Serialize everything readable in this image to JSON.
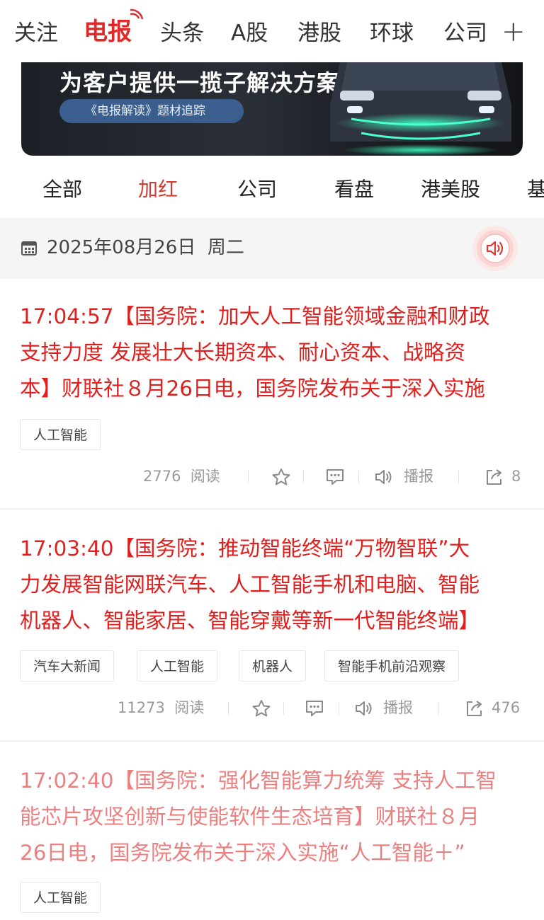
{
  "top_nav": {
    "tabs": [
      "关注",
      "电报",
      "头条",
      "A股",
      "港股",
      "环球",
      "公司"
    ],
    "active_index": 1,
    "add_label": "+"
  },
  "banner": {
    "headline": "为客户提供一揽子解决方案",
    "pill_label": "《电报解读》题材追踪"
  },
  "sub_tabs": {
    "items": [
      "全部",
      "加红",
      "公司",
      "看盘",
      "港美股",
      "基"
    ],
    "active_index": 1
  },
  "date_bar": {
    "date": "2025年08月26日",
    "weekday": "周二"
  },
  "news": [
    {
      "time": "17:04:57",
      "line1": "【国务院：加大人工智能领域金融和财政",
      "line2": "支持力度 发展壮大长期资本、耐心资本、战略资",
      "line3": "本】财联社８月26日电，国务院发布关于深入实施",
      "tags": [
        "人工智能"
      ],
      "reads": "2776",
      "read_label": "阅读",
      "broadcast_label": "播报",
      "share_count": "8"
    },
    {
      "time": "17:03:40",
      "line1": "【国务院：推动智能终端“万物智联”大",
      "line2": "力发展智能网联汽车、人工智能手机和电脑、智能",
      "line3": "机器人、智能家居、智能穿戴等新一代智能终端】",
      "tags": [
        "汽车大新闻",
        "人工智能",
        "机器人",
        "智能手机前沿观察"
      ],
      "reads": "11273",
      "read_label": "阅读",
      "broadcast_label": "播报",
      "share_count": "476"
    },
    {
      "time": "17:02:40",
      "line1": "【国务院：强化智能算力统筹 支持人工智",
      "line2": "能芯片攻坚创新与使能软件生态培育】财联社８月",
      "line3": "26日电，国务院发布关于深入实施“人工智能＋”",
      "tags": [
        "人工智能"
      ]
    }
  ],
  "colors": {
    "accent_red": "#e0201e",
    "faded_red": "#ec8080",
    "date_bar_bg": "#f5f5f5"
  },
  "icons": [
    "signal-icon",
    "plus-icon",
    "calendar-icon",
    "speaker-icon",
    "star-icon",
    "comment-icon",
    "broadcast-icon",
    "share-icon"
  ]
}
